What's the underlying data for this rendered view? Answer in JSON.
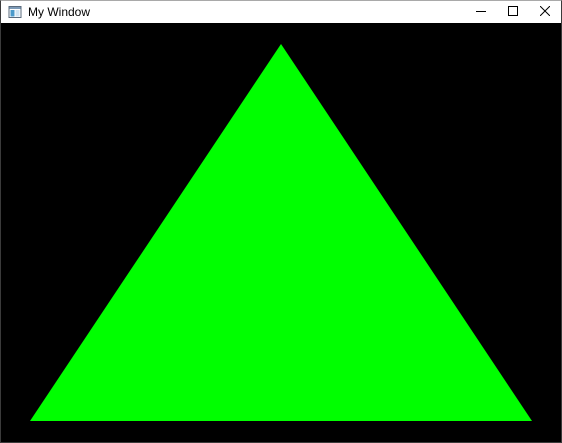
{
  "window": {
    "title": "My Window",
    "app_icon": "window-app-icon",
    "controls": {
      "minimize_icon": "minimize-icon",
      "maximize_icon": "maximize-icon",
      "close_icon": "close-icon"
    }
  },
  "canvas": {
    "background_color": "#000000",
    "triangle": {
      "fill_color": "#00ff00"
    }
  }
}
